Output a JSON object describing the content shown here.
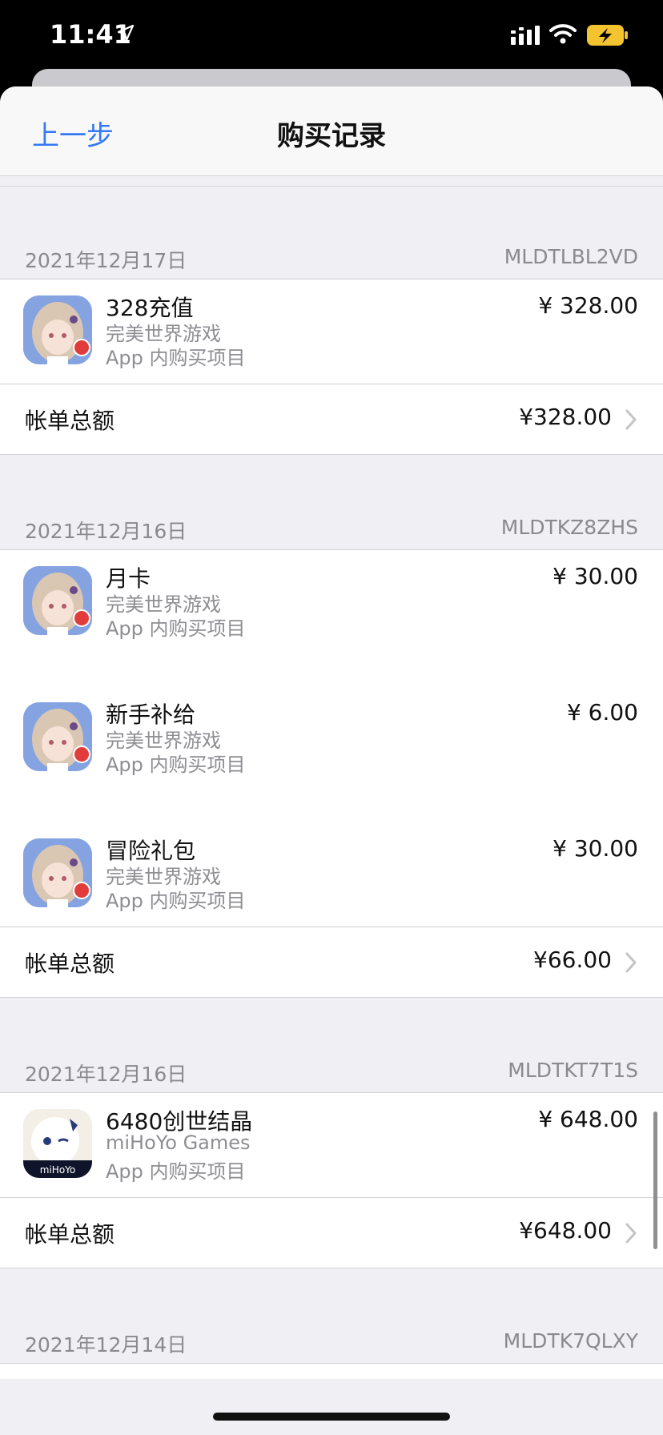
{
  "status": {
    "time": "11:41"
  },
  "nav": {
    "back": "上一步",
    "title": "购买记录"
  },
  "sections": [
    {
      "date": "2021年12月17日",
      "id": "MLDTLBL2VD",
      "items": [
        {
          "name": "328充值",
          "developer": "完美世界游戏",
          "type": "App 内购买项目",
          "price": "¥ 328.00",
          "icon": "game-icon-girl"
        }
      ],
      "total_label": "帐单总额",
      "total": "¥328.00"
    },
    {
      "date": "2021年12月16日",
      "id": "MLDTKZ8ZHS",
      "items": [
        {
          "name": "月卡",
          "developer": "完美世界游戏",
          "type": "App 内购买项目",
          "price": "¥ 30.00",
          "icon": "game-icon-girl"
        },
        {
          "name": "新手补给",
          "developer": "完美世界游戏",
          "type": "App 内购买项目",
          "price": "¥ 6.00",
          "icon": "game-icon-girl"
        },
        {
          "name": "冒险礼包",
          "developer": "完美世界游戏",
          "type": "App 内购买项目",
          "price": "¥ 30.00",
          "icon": "game-icon-girl"
        }
      ],
      "total_label": "帐单总额",
      "total": "¥66.00"
    },
    {
      "date": "2021年12月16日",
      "id": "MLDTKT7T1S",
      "items": [
        {
          "name": "6480创世结晶",
          "developer": "miHoYo Games",
          "type": "App 内购买项目",
          "price": "¥ 648.00",
          "icon": "mihoyo-icon",
          "icon_label": "miHoYo"
        }
      ],
      "total_label": "帐单总额",
      "total": "¥648.00"
    },
    {
      "date": "2021年12月14日",
      "id": "MLDTK7QLXY"
    }
  ]
}
